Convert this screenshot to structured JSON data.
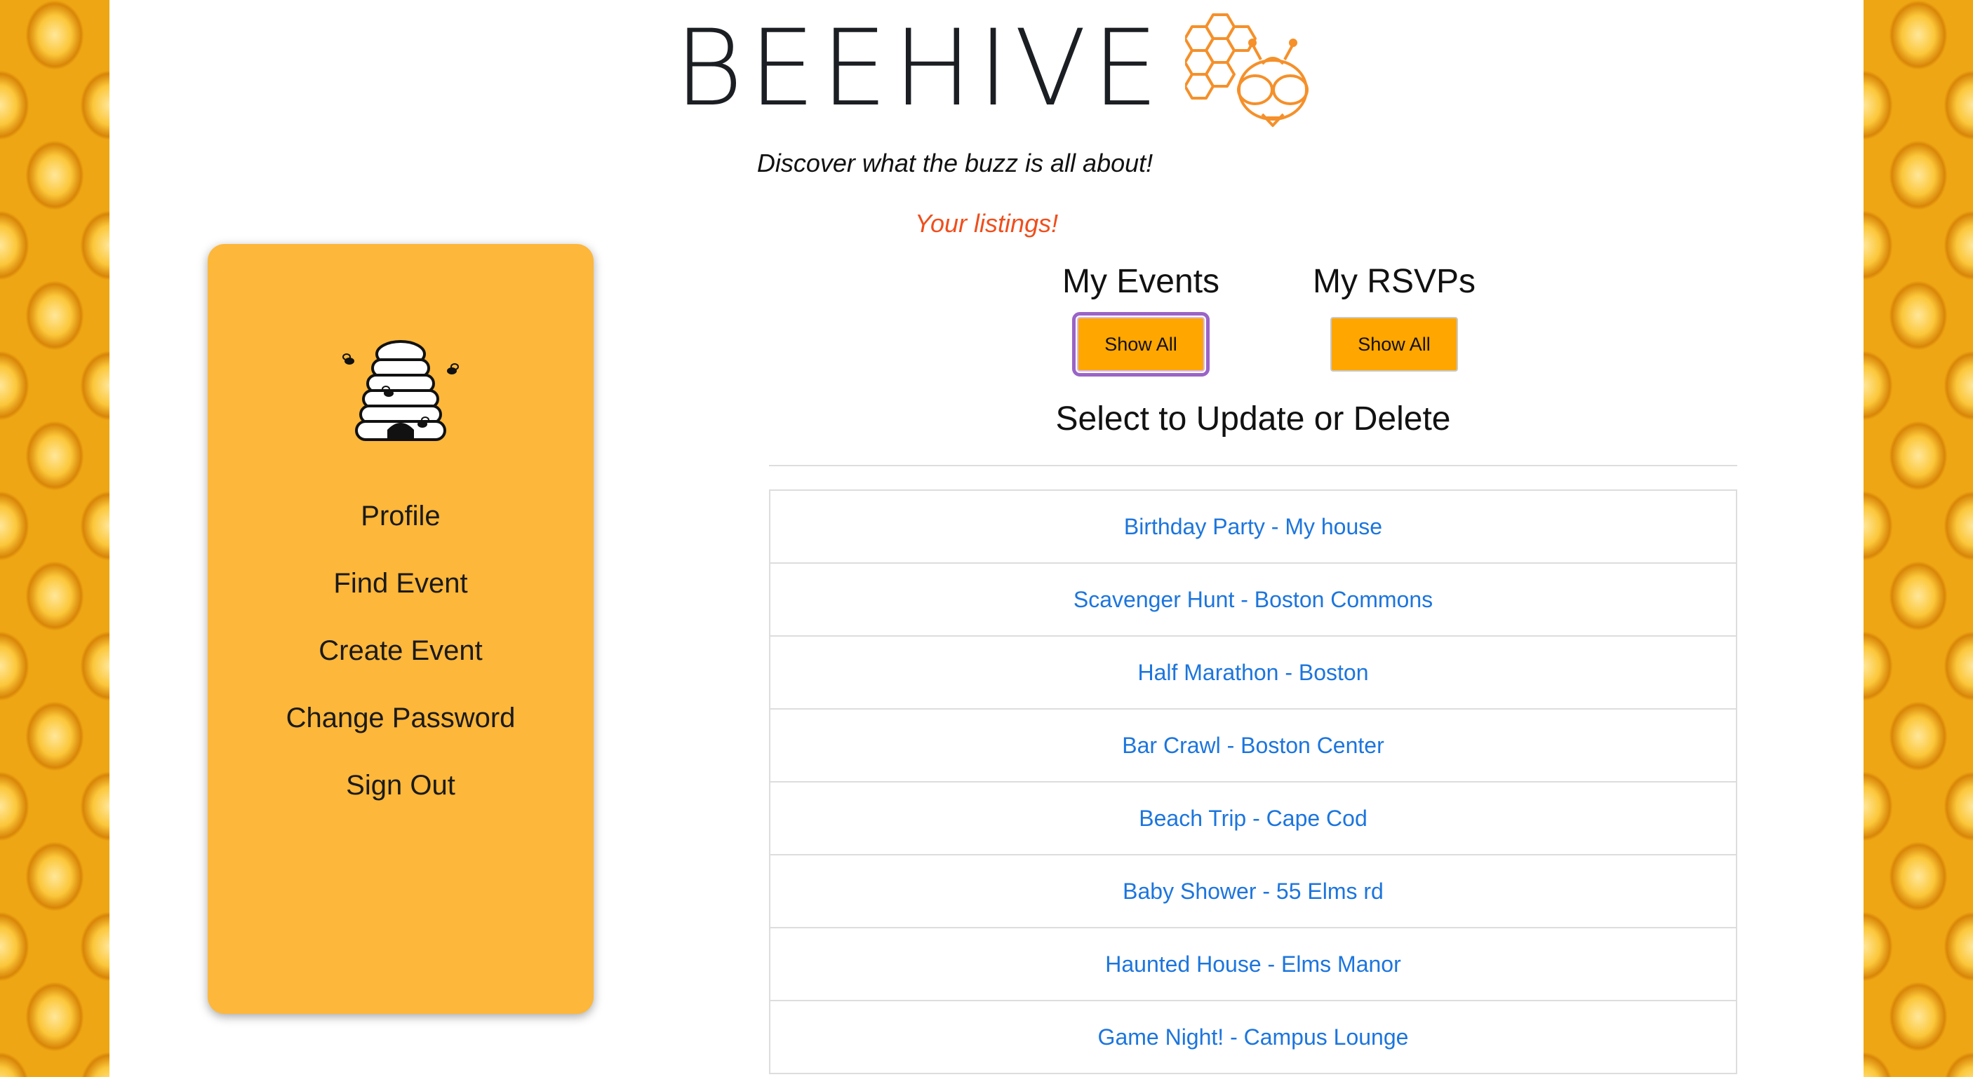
{
  "header": {
    "brand_title": "BEEHIVE",
    "tagline": "Discover what the buzz is all about!",
    "listings_label": "Your listings!"
  },
  "sidebar": {
    "items": [
      {
        "label": "Profile"
      },
      {
        "label": "Find Event"
      },
      {
        "label": "Create Event"
      },
      {
        "label": "Change Password"
      },
      {
        "label": "Sign Out"
      }
    ]
  },
  "tabs": {
    "my_events": {
      "title": "My Events",
      "button": "Show All"
    },
    "my_rsvps": {
      "title": "My RSVPs",
      "button": "Show All"
    }
  },
  "events": {
    "heading": "Select to Update or Delete",
    "items": [
      "Birthday Party - My house",
      "Scavenger Hunt - Boston Commons",
      "Half Marathon - Boston",
      "Bar Crawl - Boston Center",
      "Beach Trip - Cape Cod",
      "Baby Shower - 55 Elms rd",
      "Haunted House - Elms Manor",
      "Game Night! - Campus Lounge"
    ]
  },
  "colors": {
    "sidebar_bg": "#fdb73a",
    "button_bg": "#ffa600",
    "link": "#1c75dd",
    "listings_accent": "#ee4f1d",
    "logo_orange": "#f5902a"
  },
  "icons": {
    "brand_logo": "bee-honeycomb-icon",
    "sidebar_logo": "beehive-icon"
  }
}
